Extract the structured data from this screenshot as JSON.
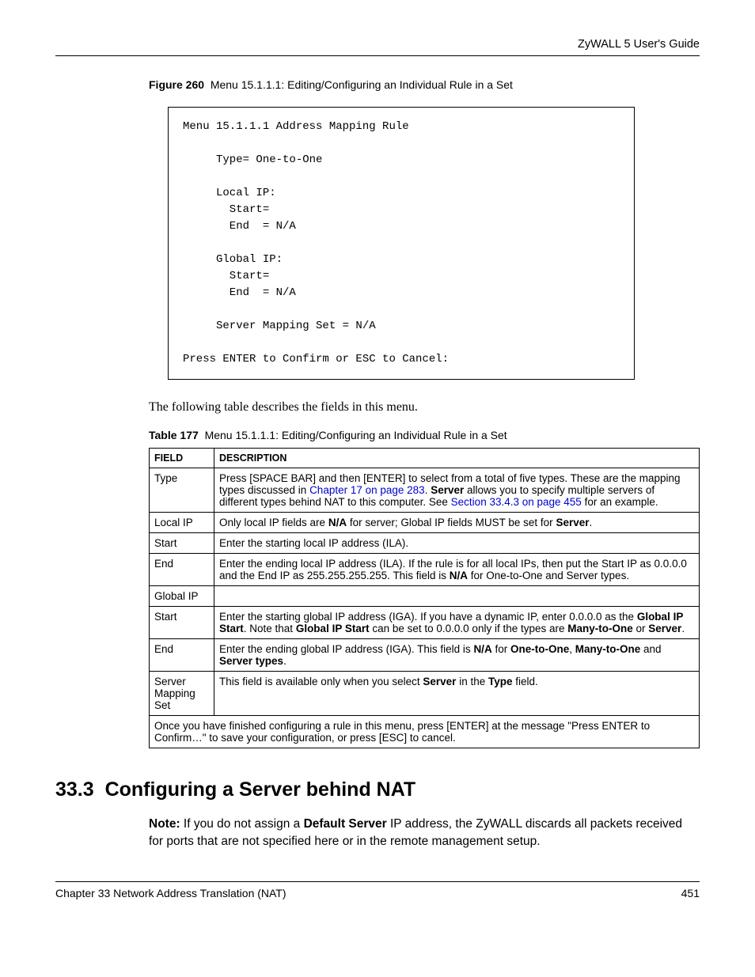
{
  "header": {
    "title": "ZyWALL 5 User's Guide"
  },
  "figure": {
    "label": "Figure 260",
    "caption": "Menu 15.1.1.1: Editing/Configuring an Individual Rule in a Set",
    "content": "Menu 15.1.1.1 Address Mapping Rule\n\n     Type= One-to-One\n\n     Local IP:\n       Start=\n       End  = N/A\n\n     Global IP:\n       Start=\n       End  = N/A\n\n     Server Mapping Set = N/A\n\nPress ENTER to Confirm or ESC to Cancel:"
  },
  "intro": "The following table describes the fields in this menu.",
  "table": {
    "label": "Table 177",
    "caption": "Menu 15.1.1.1: Editing/Configuring an Individual Rule in a Set",
    "headers": {
      "field": "FIELD",
      "description": "DESCRIPTION"
    },
    "rows": {
      "type": {
        "field": "Type",
        "pre": "Press [SPACE BAR] and then [ENTER] to select from a total of five types. These are the mapping types discussed in ",
        "link1": "Chapter 17 on page 283",
        "mid": ". ",
        "bold1": "Server",
        "post1": " allows you to specify multiple servers of different types behind NAT to this computer. See ",
        "link2": "Section 33.4.3 on page 455",
        "post2": " for an example."
      },
      "localip": {
        "field": "Local IP",
        "pre": "Only local IP fields are ",
        "b1": "N/A",
        "mid": " for server; Global IP fields MUST be set for ",
        "b2": "Server",
        "post": "."
      },
      "start1": {
        "field": "Start",
        "desc": "Enter the starting local IP address (ILA)."
      },
      "end1": {
        "field": "End",
        "pre": "Enter the ending local IP address (ILA). If the rule is for all local IPs, then put the Start IP as 0.0.0.0 and the End IP as 255.255.255.255. This field is ",
        "b1": "N/A",
        "post": " for One-to-One and Server types."
      },
      "globalip": {
        "field": "Global IP",
        "desc": ""
      },
      "start2": {
        "field": "Start",
        "pre": "Enter the starting global IP address (IGA). If you have a dynamic IP, enter 0.0.0.0 as the ",
        "b1": "Global IP Start",
        "mid": ". Note that ",
        "b2": "Global IP Start",
        "mid2": " can be set to 0.0.0.0 only if the types are ",
        "b3": "Many-to-One",
        "mid3": " or ",
        "b4": "Server",
        "post": "."
      },
      "end2": {
        "field": "End",
        "pre": "Enter the ending global IP address (IGA). This field is ",
        "b1": "N/A",
        "mid": " for ",
        "b2": "One-to-One",
        "mid2": ", ",
        "b3": "Many-to-One",
        "mid3": " and ",
        "b4": "Server types",
        "post": "."
      },
      "serverset": {
        "field": "Server Mapping Set",
        "pre": "This field is available only when you select ",
        "b1": "Server",
        "mid": " in the ",
        "b2": "Type",
        "post": " field."
      },
      "footer": "Once you have finished configuring a rule in this menu, press [ENTER] at the message \"Press ENTER to Confirm…\" to save your configuration, or press [ESC] to cancel."
    }
  },
  "section": {
    "number": "33.3",
    "title": "Configuring a Server behind NAT"
  },
  "note": {
    "label": "Note:",
    "pre": " If you do not assign a ",
    "b1": "Default Server",
    "post": " IP address, the ZyWALL discards all packets received for ports that are not specified here or in the remote management setup."
  },
  "footer": {
    "chapter": "Chapter 33 Network Address Translation (NAT)",
    "page": "451"
  }
}
